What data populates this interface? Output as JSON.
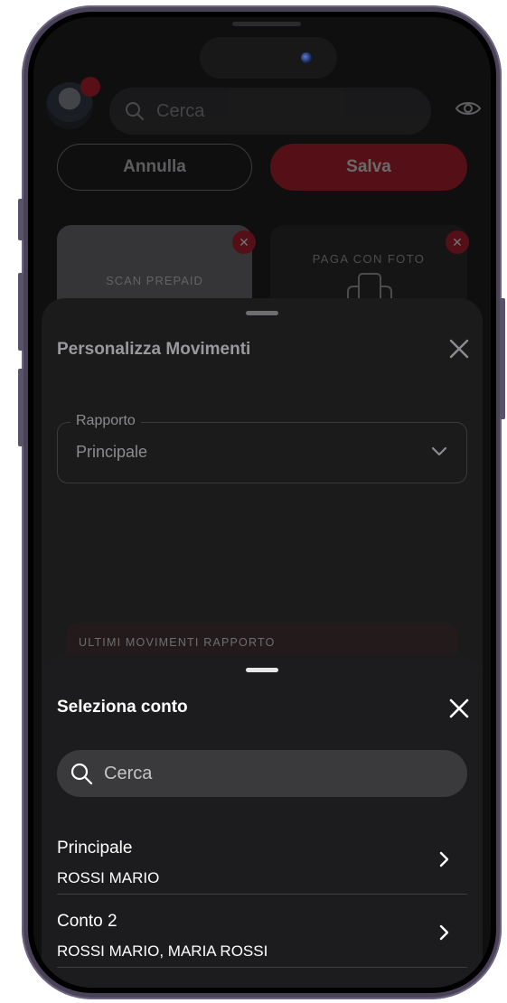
{
  "background": {
    "search_placeholder": "Cerca",
    "cancel_label": "Annulla",
    "save_label": "Salva",
    "card1_label": "SCAN PREPAID",
    "card2_label": "PAGA CON FOTO"
  },
  "sheet1": {
    "title": "Personalizza Movimenti",
    "field_label": "Rapporto",
    "field_value": "Principale",
    "section_label": "ULTIMI MOVIMENTI RAPPORTO"
  },
  "sheet2": {
    "title": "Seleziona conto",
    "search_placeholder": "Cerca",
    "accounts": [
      {
        "name": "Principale",
        "holders": "ROSSI MARIO"
      },
      {
        "name": "Conto 2",
        "holders": "ROSSI MARIO, MARIA ROSSI"
      }
    ]
  },
  "colors": {
    "brand_red": "#c1121f",
    "sheet_bg": "#1c1c1e",
    "search_bg": "#3a3a3c"
  },
  "icons": [
    "search-icon",
    "eye-icon",
    "close-icon",
    "chevron-down-icon",
    "chevron-right-icon",
    "camera-phone-icon"
  ]
}
